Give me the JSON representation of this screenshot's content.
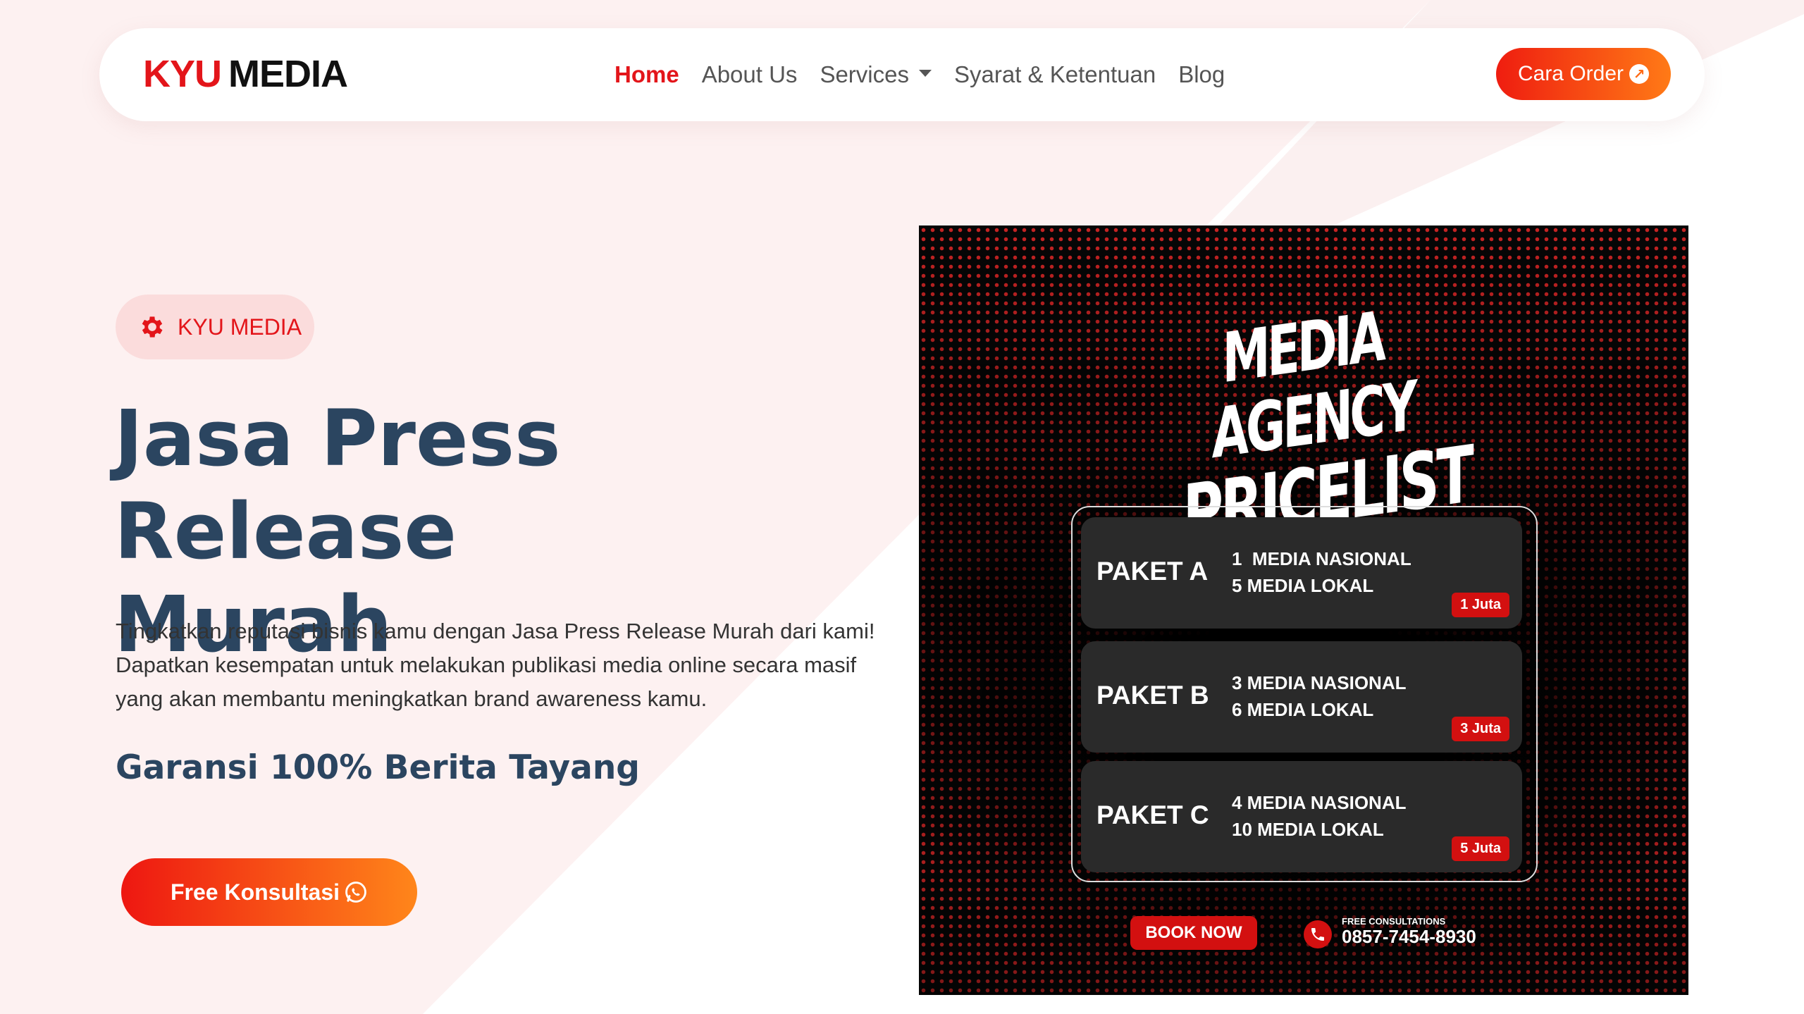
{
  "brand": {
    "logo_part1": "KYU",
    "logo_part2": "MEDIA"
  },
  "nav": {
    "links": [
      {
        "label": "Home",
        "active": true
      },
      {
        "label": "About Us"
      },
      {
        "label": "Services",
        "dropdown": true
      },
      {
        "label": "Syarat & Ketentuan"
      },
      {
        "label": "Blog"
      }
    ],
    "cta_label": "Cara Order"
  },
  "hero": {
    "badge_label": "KYU MEDIA",
    "title_line1": "Jasa Press Release",
    "title_line2": "Murah",
    "description": "Tingkatkan reputasi bisnis kamu dengan Jasa Press Release Murah dari kami! Dapatkan kesempatan untuk melakukan publikasi media online secara masif yang akan membantu meningkatkan brand awareness kamu.",
    "subtitle": "Garansi 100% Berita Tayang",
    "cta_label": "Free Konsultasi"
  },
  "poster": {
    "title_line1": "MEDIA AGENCY",
    "title_line2": "PRICELIST",
    "packages": [
      {
        "name": "PAKET A",
        "line1": "1  MEDIA NASIONAL",
        "line2": "5 MEDIA LOKAL",
        "price": "1 Juta"
      },
      {
        "name": "PAKET B",
        "line1": "3 MEDIA NASIONAL",
        "line2": "6 MEDIA LOKAL",
        "price": "3 Juta"
      },
      {
        "name": "PAKET C",
        "line1": "4 MEDIA NASIONAL",
        "line2": "10 MEDIA LOKAL",
        "price": "5 Juta"
      }
    ],
    "book_label": "BOOK NOW",
    "consult_label": "FREE CONSULTATIONS",
    "phone": "0857-7454-8930"
  },
  "colors": {
    "accent": "#e3151a",
    "heading": "#2b4560",
    "gradient_start": "#ee1711",
    "gradient_end": "#ff861a"
  },
  "icons": [
    "gear-icon",
    "arrow-up-right-icon",
    "whatsapp-icon",
    "chevron-down-icon",
    "phone-icon"
  ]
}
